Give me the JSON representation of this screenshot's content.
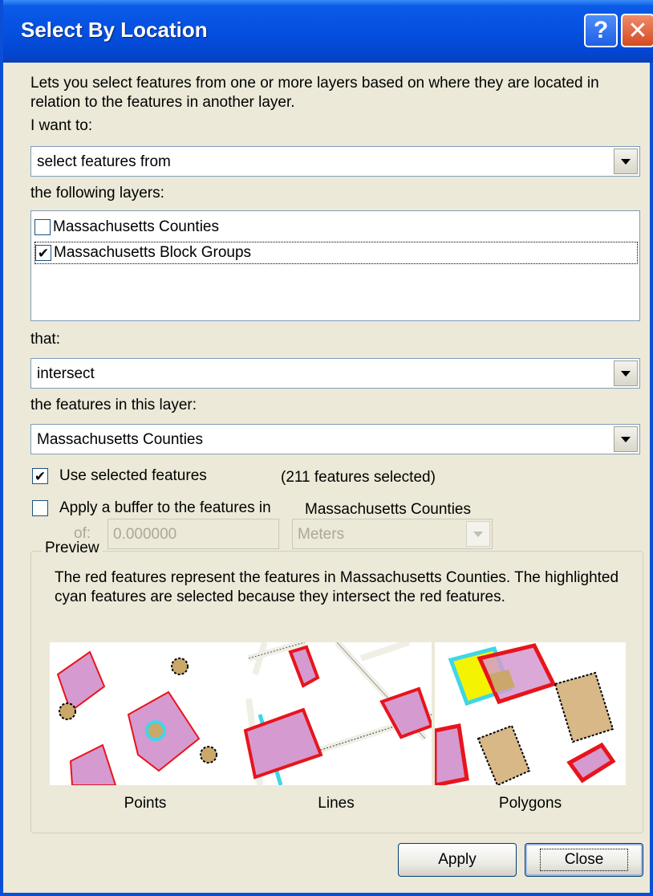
{
  "window": {
    "title": "Select By Location",
    "help_glyph": "?",
    "close_glyph": "✕"
  },
  "description": "Lets you select features from one or more layers based on where they are located in relation to the features in another layer.",
  "i_want_to": {
    "label": "I want to:",
    "value": "select features from"
  },
  "layers": {
    "label": "the following layers:",
    "items": [
      {
        "label": "Massachusetts Counties",
        "checked": false
      },
      {
        "label": "Massachusetts Block Groups",
        "checked": true
      }
    ]
  },
  "that": {
    "label": "that:",
    "value": "intersect"
  },
  "source_layer": {
    "label": "the features in this layer:",
    "value": "Massachusetts Counties"
  },
  "use_selected": {
    "label": "Use selected features",
    "checked": true,
    "count_text": "(211 features selected)"
  },
  "buffer": {
    "label": "Apply a buffer to the features in",
    "layer_name": "Massachusetts Counties",
    "checked": false,
    "of_label": "of:",
    "distance": "0.000000",
    "units": "Meters"
  },
  "preview": {
    "legend": "Preview",
    "text": "The red features represent the features in Massachusetts Counties. The highlighted cyan features are selected because they intersect the red features.",
    "captions": [
      "Points",
      "Lines",
      "Polygons"
    ]
  },
  "buttons": {
    "apply": "Apply",
    "close": "Close"
  },
  "colors": {
    "source_red": "#e8141c",
    "selected_cyan": "#3fd6e8",
    "feature_pink": "#d59ad0",
    "feature_tan": "#d8b887",
    "highlight_yellow": "#f4f400",
    "titlebar_blue": "#0550e0",
    "dialog_bg": "#ece9d8"
  }
}
